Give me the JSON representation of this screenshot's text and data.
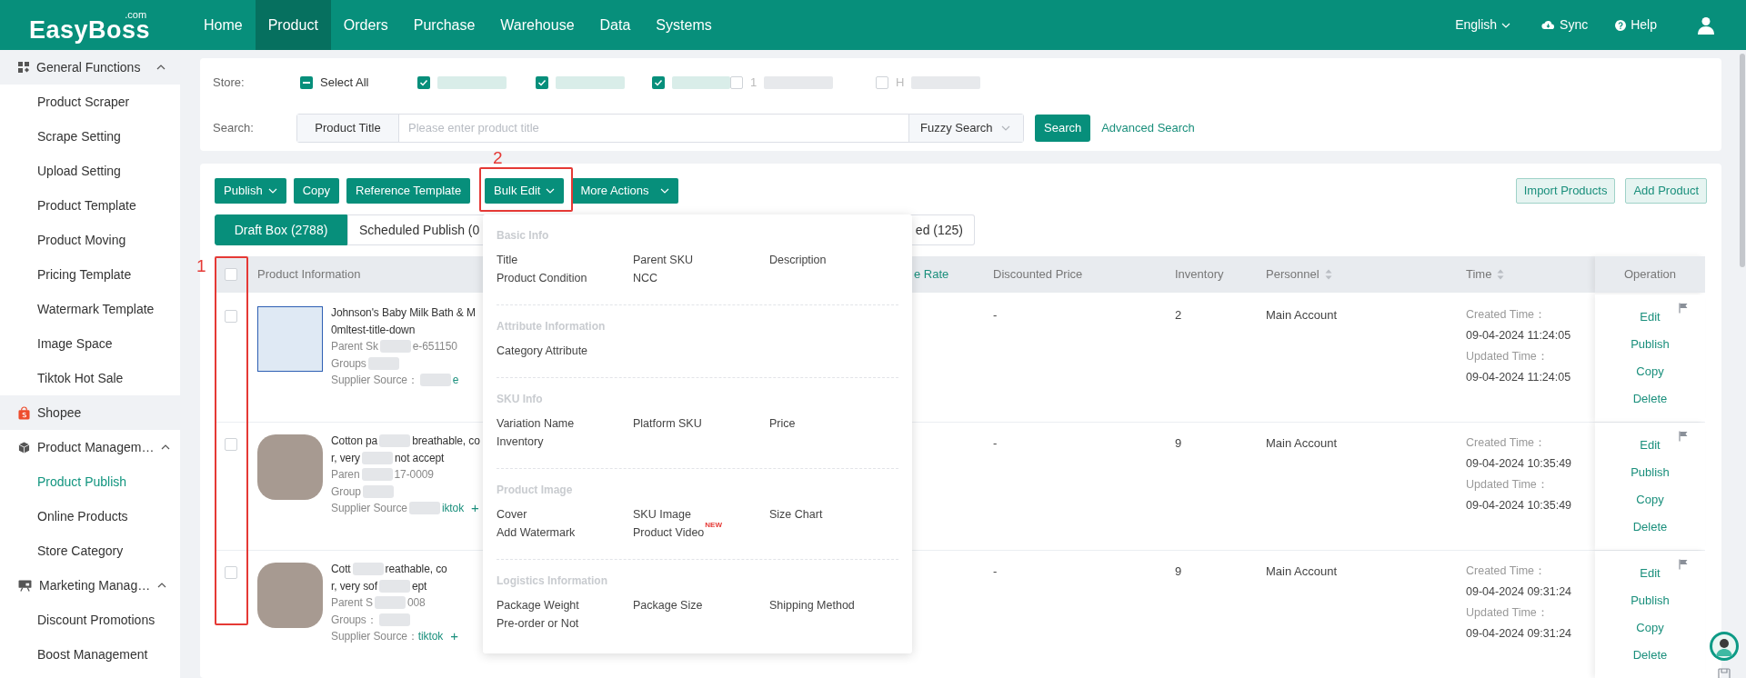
{
  "header": {
    "logo": "EasyBoss",
    "logo_suffix": ".com",
    "nav": [
      {
        "label": "Home",
        "selected": false
      },
      {
        "label": "Product",
        "selected": true
      },
      {
        "label": "Orders",
        "selected": false
      },
      {
        "label": "Purchase",
        "selected": false
      },
      {
        "label": "Warehouse",
        "selected": false
      },
      {
        "label": "Data",
        "selected": false
      },
      {
        "label": "Systems",
        "selected": false
      }
    ],
    "language": "English",
    "sync": "Sync",
    "help": "Help"
  },
  "sidebar": {
    "sections": [
      {
        "label": "General Functions",
        "kind": "top",
        "expanded": true,
        "children": [
          {
            "label": "Product Scraper",
            "selected": false
          },
          {
            "label": "Scrape Setting",
            "selected": false
          },
          {
            "label": "Upload Setting",
            "selected": false
          },
          {
            "label": "Product Template",
            "selected": false
          },
          {
            "label": "Product Moving",
            "selected": false
          },
          {
            "label": "Pricing Template",
            "selected": false
          },
          {
            "label": "Watermark Template",
            "selected": false
          },
          {
            "label": "Image Space",
            "selected": false
          },
          {
            "label": "Tiktok Hot Sale",
            "selected": false
          }
        ]
      },
      {
        "label": "Shopee",
        "kind": "platform"
      },
      {
        "label": "Product Managem…",
        "kind": "group",
        "expanded": true,
        "children": [
          {
            "label": "Product Publish",
            "selected": true
          },
          {
            "label": "Online Products",
            "selected": false
          },
          {
            "label": "Store Category",
            "selected": false
          }
        ]
      },
      {
        "label": "Marketing Manag…",
        "kind": "group",
        "expanded": true,
        "children": [
          {
            "label": "Discount Promotions",
            "selected": false
          },
          {
            "label": "Boost Management",
            "selected": false
          }
        ]
      }
    ]
  },
  "filters": {
    "store_label": "Store:",
    "stores": [
      {
        "label": "Select All",
        "indeterminate": true
      },
      {
        "checked": true,
        "redacted": true
      },
      {
        "checked": true,
        "redacted": true
      },
      {
        "checked": true,
        "redacted": true
      },
      {
        "label": "1",
        "checked": false,
        "redacted": true
      },
      {
        "label": "H",
        "checked": false,
        "redacted": true
      }
    ],
    "search_label": "Search:",
    "search_field": "Product Title",
    "placeholder": "Please enter product title",
    "match_mode": "Fuzzy Search",
    "search_button": "Search",
    "advanced_search": "Advanced Search"
  },
  "toolbar": {
    "buttons": [
      {
        "label": "Publish",
        "dropdown": true
      },
      {
        "label": "Copy",
        "dropdown": false
      },
      {
        "label": "Reference Template",
        "dropdown": false
      },
      {
        "label": "Bulk Edit",
        "dropdown": true
      },
      {
        "label": "More Actions",
        "dropdown": true
      }
    ],
    "right_buttons": [
      "Import Products",
      "Add Product"
    ]
  },
  "tabs": [
    {
      "label": "Draft Box (2788)",
      "selected": true
    },
    {
      "label": "Scheduled Publish (0",
      "selected": false
    },
    {
      "label": "ed (125)",
      "selected": false
    }
  ],
  "table": {
    "select_all_checked": false,
    "columns": [
      {
        "label": "Product Information",
        "kind": "plain"
      },
      {
        "label": "e Rate",
        "kind": "link"
      },
      {
        "label": "Discounted Price",
        "kind": "plain"
      },
      {
        "label": "Inventory",
        "kind": "plain"
      },
      {
        "label": "Personnel",
        "kind": "sortable"
      },
      {
        "label": "Time",
        "kind": "sortable"
      },
      {
        "label": "Operation",
        "kind": "plain"
      }
    ],
    "rows": [
      {
        "checked": false,
        "info_lines": [
          [
            {
              "kind": "title",
              "text": "Johnson's Baby Milk Bath & M"
            }
          ],
          [
            {
              "kind": "title",
              "text": "0mltest-title-down"
            }
          ],
          [
            {
              "kind": "label",
              "text": "Parent Sk"
            },
            {
              "kind": "redacted"
            },
            {
              "kind": "label",
              "text": "e-651150"
            }
          ],
          [
            {
              "kind": "label",
              "text": "Groups"
            },
            {
              "kind": "redacted"
            }
          ],
          [
            {
              "kind": "label",
              "text": "Supplier Source："
            },
            {
              "kind": "redacted"
            },
            {
              "kind": "link",
              "text": "e"
            }
          ]
        ],
        "discounted_price": "-",
        "inventory": "2",
        "personnel": "Main Account",
        "created_label": "Created Time：",
        "created": "09-04-2024 11:24:05",
        "updated_label": "Updated Time：",
        "updated": "09-04-2024 11:24:05",
        "actions": [
          "Edit",
          "Publish",
          "Copy",
          "Delete"
        ]
      },
      {
        "checked": false,
        "info_lines": [
          [
            {
              "kind": "title",
              "text": "Cotton pa"
            },
            {
              "kind": "redacted"
            },
            {
              "kind": "title",
              "text": "breathable, co"
            }
          ],
          [
            {
              "kind": "title",
              "text": "r, very"
            },
            {
              "kind": "redacted"
            },
            {
              "kind": "title",
              "text": "not accept"
            }
          ],
          [
            {
              "kind": "label",
              "text": "Paren"
            },
            {
              "kind": "redacted"
            },
            {
              "kind": "label",
              "text": "17-0009"
            }
          ],
          [
            {
              "kind": "label",
              "text": "Group"
            },
            {
              "kind": "redacted"
            }
          ],
          [
            {
              "kind": "label",
              "text": "Supplier Source"
            },
            {
              "kind": "redacted"
            },
            {
              "kind": "link",
              "text": "iktok"
            },
            {
              "kind": "add",
              "text": "+"
            }
          ]
        ],
        "discounted_price": "-",
        "inventory": "9",
        "personnel": "Main Account",
        "created_label": "Created Time：",
        "created": "09-04-2024 10:35:49",
        "updated_label": "Updated Time：",
        "updated": "09-04-2024 10:35:49",
        "actions": [
          "Edit",
          "Publish",
          "Copy",
          "Delete"
        ]
      },
      {
        "checked": false,
        "info_lines": [
          [
            {
              "kind": "title",
              "text": "Cott"
            },
            {
              "kind": "redacted"
            },
            {
              "kind": "title",
              "text": "reathable, co"
            }
          ],
          [
            {
              "kind": "title",
              "text": "r, very sof"
            },
            {
              "kind": "redacted"
            },
            {
              "kind": "title",
              "text": "ept"
            }
          ],
          [
            {
              "kind": "label",
              "text": "Parent S"
            },
            {
              "kind": "redacted"
            },
            {
              "kind": "label",
              "text": "008"
            }
          ],
          [
            {
              "kind": "label",
              "text": "Groups："
            },
            {
              "kind": "redacted"
            }
          ],
          [
            {
              "kind": "label",
              "text": "Supplier Source："
            },
            {
              "kind": "link",
              "text": "tiktok"
            },
            {
              "kind": "add",
              "text": "+"
            }
          ]
        ],
        "discounted_price": "-",
        "inventory": "9",
        "personnel": "Main Account",
        "created_label": "Created Time：",
        "created": "09-04-2024 09:31:24",
        "updated_label": "Updated Time：",
        "updated": "09-04-2024 09:31:24",
        "actions": [
          "Edit",
          "Publish",
          "Copy",
          "Delete"
        ]
      }
    ]
  },
  "bulk_edit_menu": {
    "sections": [
      {
        "title": "Basic Info",
        "items": [
          {
            "label": "Title"
          },
          {
            "label": "Parent SKU"
          },
          {
            "label": "Description"
          },
          {
            "label": "Product Condition"
          },
          {
            "label": "NCC"
          }
        ]
      },
      {
        "title": "Attribute Information",
        "items": [
          {
            "label": "Category Attribute"
          }
        ]
      },
      {
        "title": "SKU Info",
        "items": [
          {
            "label": "Variation Name"
          },
          {
            "label": "Platform SKU"
          },
          {
            "label": "Price"
          },
          {
            "label": "Inventory"
          }
        ]
      },
      {
        "title": "Product Image",
        "items": [
          {
            "label": "Cover"
          },
          {
            "label": "SKU Image"
          },
          {
            "label": "Size Chart"
          },
          {
            "label": "Add Watermark"
          },
          {
            "label": "Product Video",
            "badge": "NEW"
          }
        ]
      },
      {
        "title": "Logistics Information",
        "items": [
          {
            "label": "Package Weight"
          },
          {
            "label": "Package Size"
          },
          {
            "label": "Shipping Method"
          },
          {
            "label": "Pre-order or Not"
          }
        ]
      }
    ]
  },
  "annotations": [
    {
      "number": "1",
      "kind": "column"
    },
    {
      "number": "2",
      "kind": "button"
    }
  ]
}
